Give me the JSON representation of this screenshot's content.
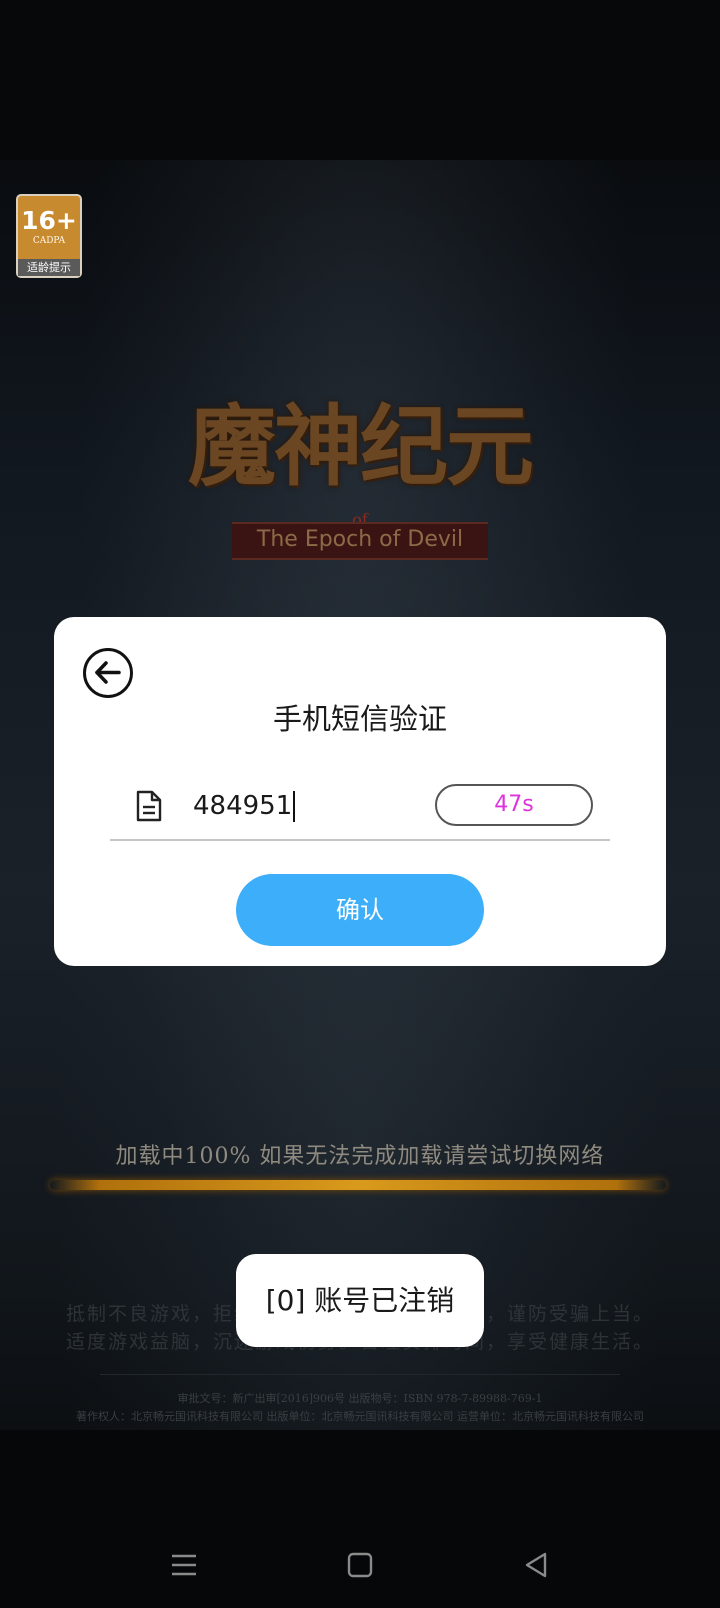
{
  "age_rating": {
    "age": "16+",
    "org": "CADPA",
    "tip": "适龄提示"
  },
  "game_logo": {
    "title": "魔神纪元",
    "of": "of",
    "subtitle": "The Epoch of Devil"
  },
  "dialog": {
    "title": "手机短信验证",
    "code_value": "484951",
    "countdown": "47s",
    "confirm_label": "确认",
    "back_icon": "arrow-left-circle-icon",
    "field_icon": "document-icon"
  },
  "loading": {
    "text": "加载中100% 如果无法完成加载请尝试切换网络"
  },
  "health_notice": {
    "line1": "抵制不良游戏，拒绝盗版游戏。注意自我保护，谨防受骗上当。",
    "line2": "适度游戏益脑，沉迷游戏伤身。合理安排时间，享受健康生活。"
  },
  "copyright": {
    "line1": "审批文号：新广出审[2016]906号 出版物号：ISBN 978-7-89988-769-1",
    "line2": "著作权人：北京畅元国讯科技有限公司 出版单位：北京畅元国讯科技有限公司 运营单位：北京畅元国讯科技有限公司"
  },
  "toast": {
    "message": "[0] 账号已注销"
  },
  "nav": {
    "menu_icon": "menu-icon",
    "home_icon": "home-square-icon",
    "back_icon": "back-triangle-icon"
  },
  "colors": {
    "confirm_button": "#3daef9",
    "countdown_text": "#dd33dd",
    "loading_bar": "#d99a1c"
  }
}
